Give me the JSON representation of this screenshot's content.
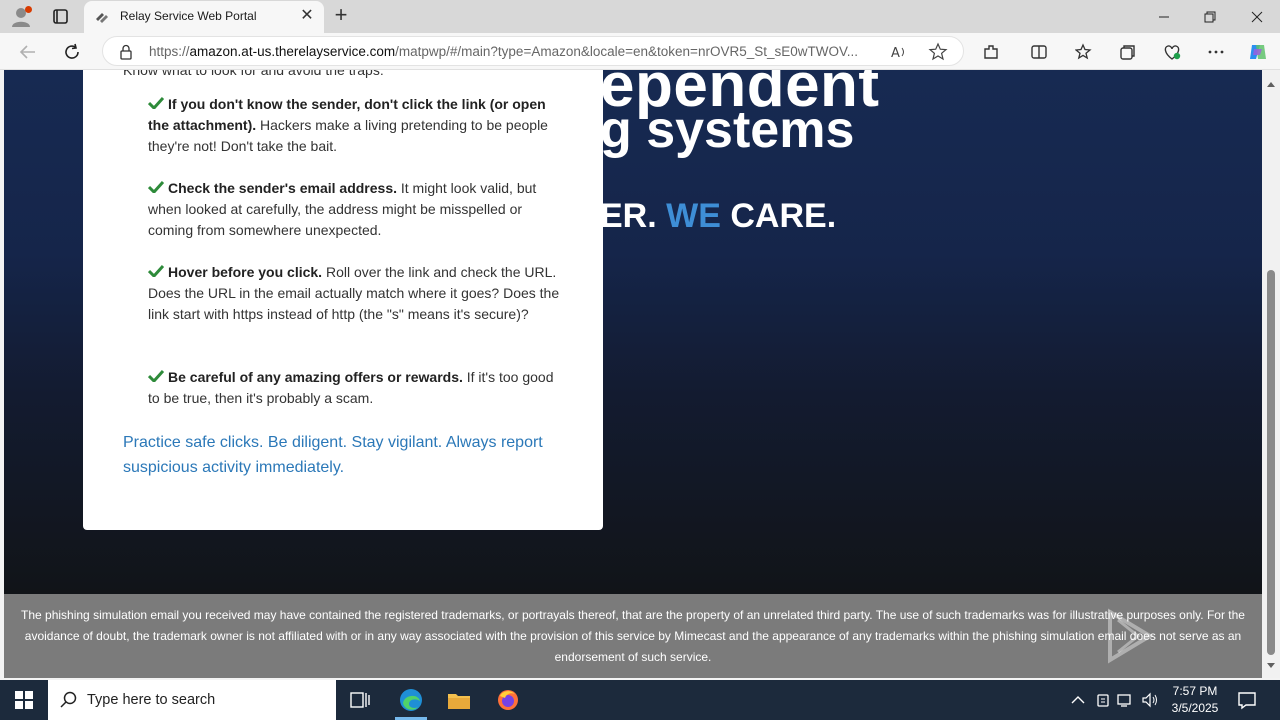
{
  "browser": {
    "tab_title": "Relay Service Web Portal",
    "url_host": "amazon.at-us.therelayservice.com",
    "url_prefix": "https://",
    "url_rest": "/matpwp/#/main?type=Amazon&locale=en&token=nrOVR5_St_sE0wTWOV..."
  },
  "hero": {
    "line1": "ependent",
    "line2": "g systems",
    "tag_before": "ER. ",
    "tag_we": "WE",
    "tag_after": " CARE."
  },
  "card": {
    "intro": "Know what to look for and avoid the traps:",
    "tips": [
      {
        "bold": "If you don't know the sender, don't click the link (or open the attachment).",
        "text": " Hackers make a living pretending to be people they're not! Don't take the bait."
      },
      {
        "bold": "Check the sender's email address.",
        "text": " It might look valid, but when looked at carefully, the address might be misspelled or coming from somewhere unexpected."
      },
      {
        "bold": "Hover before you click.",
        "text": " Roll over the link and check the URL. Does the URL in the email actually match where it goes? Does the link start with https instead of http (the \"s\" means it's secure)?"
      },
      {
        "bold": "Be careful of any amazing offers or rewards.",
        "text": " If it's too good to be true, then it's probably a scam."
      }
    ],
    "closing": "Practice safe clicks. Be diligent. Stay vigilant. Always report suspicious activity immediately."
  },
  "footer": {
    "disclaimer": "The phishing simulation email you received may have contained the registered trademarks, or portrayals thereof, that are the property of an unrelated third party. The use of such trademarks was for illustrative purposes only. For the avoidance of doubt, the trademark owner is not affiliated with or in any way associated with the provision of this service by Mimecast and the appearance of any trademarks within the phishing simulation email does not serve as an endorsement of such service."
  },
  "watermark": "ANY RUN",
  "taskbar": {
    "search_placeholder": "Type here to search",
    "time": "7:57 PM",
    "date": "3/5/2025"
  },
  "colors": {
    "accent_blue": "#3e8ed6",
    "link_blue": "#2b78b8",
    "check_green": "#2e8b3a",
    "hero_top": "#172a52",
    "footer_gray": "#7b7b7b"
  }
}
